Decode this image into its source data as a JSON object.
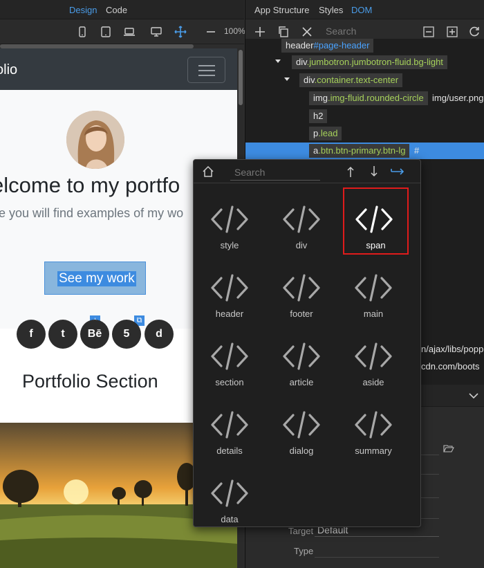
{
  "top_tabs_left": {
    "design": "Design",
    "code": "Code"
  },
  "zoom": "100%",
  "top_tabs_right": {
    "app_structure": "App Structure",
    "styles": "Styles",
    "dom": "DOM"
  },
  "dom_search": {
    "placeholder": "Search"
  },
  "dom_tree": {
    "node_header": {
      "tag": "header",
      "id": "#page-header"
    },
    "node_jumbo": {
      "tag": "div",
      "cls": ".jumbotron.jumbotron-fluid.bg-light"
    },
    "node_container": {
      "tag": "div",
      "cls": ".container.text-center"
    },
    "node_img": {
      "tag": "img",
      "cls": ".img-fluid.rounded-circle",
      "after": "img/user.png"
    },
    "node_h2": {
      "tag": "h2"
    },
    "node_p": {
      "tag": "p",
      "cls": ".lead"
    },
    "node_a": {
      "tag": "a",
      "cls": ".btn.btn-primary.btn-lg",
      "after": "#"
    }
  },
  "script_urls": {
    "url1": "n/ajax/libs/popp",
    "url2": "cdn.com/boots"
  },
  "properties": {
    "target_label": "Target",
    "target_value": "Default",
    "type_label": "Type"
  },
  "preview": {
    "brand": "olio",
    "heading": "elcome to my portfo",
    "lead": "re you will find examples of my wo",
    "button": "See my work",
    "social": [
      "f",
      "t",
      "Bē",
      "5",
      "d"
    ],
    "section_title": "Portfolio Section"
  },
  "popup": {
    "search_placeholder": "Search",
    "items": [
      "style",
      "div",
      "span",
      "header",
      "footer",
      "main",
      "section",
      "article",
      "aside",
      "details",
      "dialog",
      "summary",
      "data"
    ],
    "highlighted": "span"
  },
  "colors": {
    "accent": "#3d8be0",
    "class_green": "#a6d15a",
    "id_blue": "#4aa3ff",
    "highlight": "#e01b1b"
  }
}
